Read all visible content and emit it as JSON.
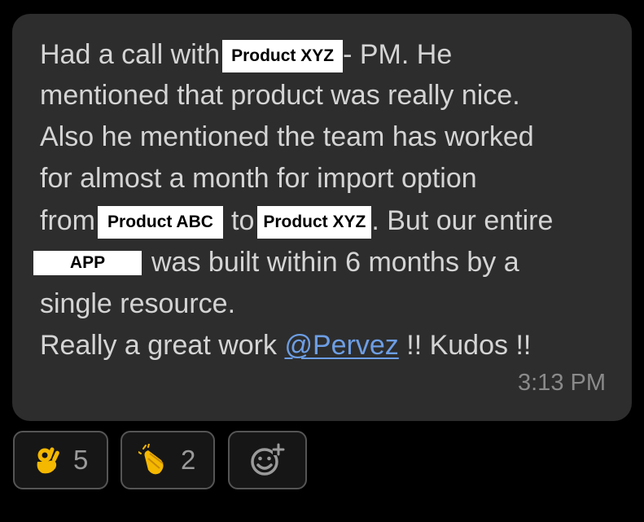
{
  "message": {
    "line1": {
      "pre": "Had a call with",
      "redact": "Product XYZ",
      "post": "- PM. He"
    },
    "line2": "mentioned that product was really nice.",
    "line3": "Also he mentioned the team has worked",
    "line4": "for almost a month for import option",
    "line5": {
      "pre": "from",
      "redact1": "Product ABC",
      "mid": "to",
      "redact2": "Product XYZ",
      "post": ". But our entire"
    },
    "line6": {
      "redact": "APP",
      "post": "was built within 6 months by a"
    },
    "line7": "single resource.",
    "line8": {
      "pre": "Really a great work ",
      "mention": "@Pervez",
      "post": " !! Kudos !!"
    },
    "timestamp": "3:13 PM"
  },
  "reactions": [
    {
      "icon": "ok-hand-icon",
      "count": "5"
    },
    {
      "icon": "clapping-hands-icon",
      "count": "2"
    }
  ],
  "add_reaction_icon": "add-reaction-icon",
  "colors": {
    "background": "#000000",
    "bubble": "#2d2d2d",
    "text": "#d4d4d4",
    "mention": "#6d9ee5",
    "timestamp": "#8a8a8a",
    "emoji_yellow": "#f5b800"
  }
}
